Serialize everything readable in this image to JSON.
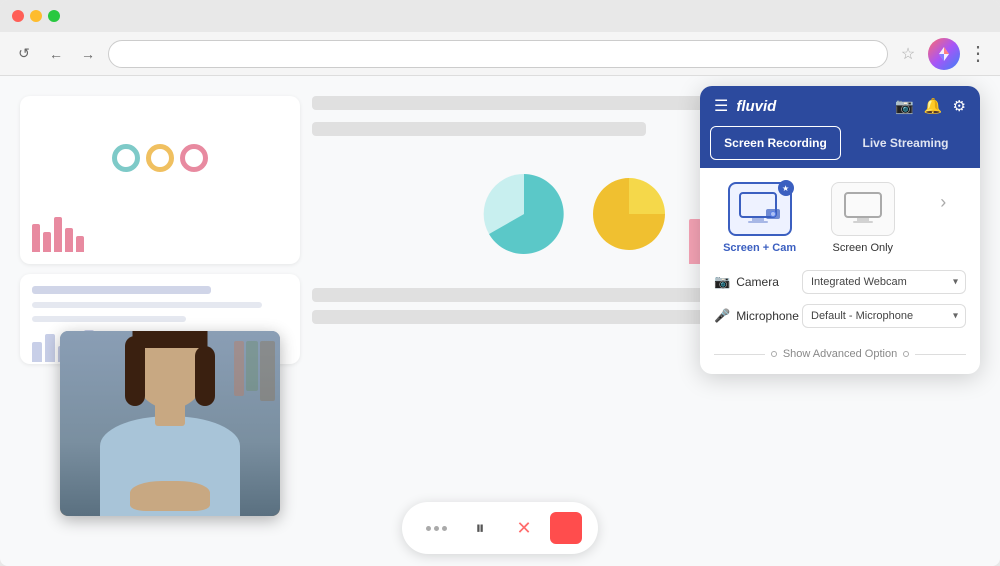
{
  "browser": {
    "traffic_lights": [
      "red",
      "yellow",
      "green"
    ],
    "address_bar_placeholder": "",
    "nav": {
      "back_label": "←",
      "forward_label": "→",
      "reload_label": "↺"
    }
  },
  "panel": {
    "logo": "fluvid",
    "tabs": [
      {
        "id": "screen-recording",
        "label": "Screen Recording",
        "active": true
      },
      {
        "id": "live-streaming",
        "label": "Live Streaming",
        "active": false
      }
    ],
    "modes": [
      {
        "id": "screen-cam",
        "label": "Screen + Cam",
        "active": true
      },
      {
        "id": "screen-only",
        "label": "Screen Only",
        "active": false
      }
    ],
    "fields": {
      "camera": {
        "label": "Camera",
        "value": "Integrated Webcam"
      },
      "microphone": {
        "label": "Microphone",
        "value": "Default - Microphone"
      }
    },
    "advanced": {
      "label": "Show Advanced Option"
    }
  },
  "controls": {
    "pause_label": "⏸",
    "cancel_label": "✕",
    "stop_color": "#ff4d4d"
  },
  "charts": {
    "pie_colors": [
      "#5bc8c8",
      "#f5d84a"
    ],
    "bar_colors": [
      "#f5a3b5",
      "#f5c842",
      "#e87070"
    ]
  }
}
